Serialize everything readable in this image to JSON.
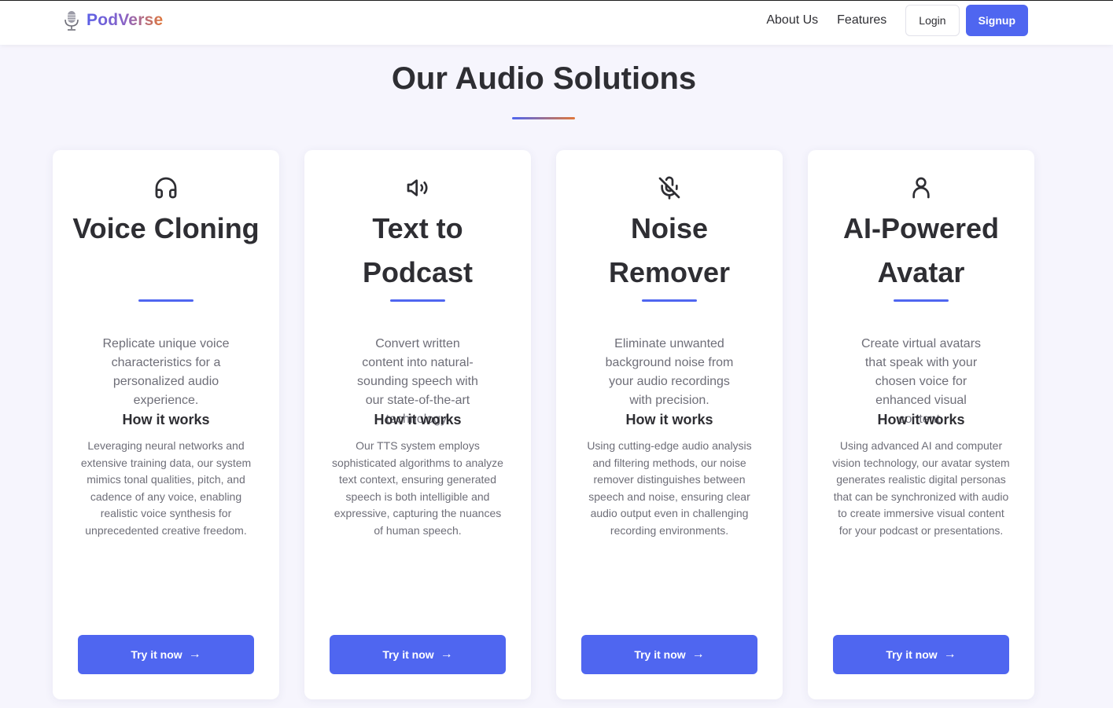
{
  "header": {
    "brand_name": "PodVerse",
    "brand_icon": "microphone-icon",
    "nav": [
      "About Us",
      "Features"
    ],
    "login_label": "Login",
    "signup_label": "Signup"
  },
  "section": {
    "title": "Our Audio Solutions"
  },
  "cards": [
    {
      "icon": "headphones-icon",
      "title": "Voice Cloning",
      "description": "Replicate unique voice characteristics for a personalized audio experience.",
      "how_label": "How it works",
      "detail": "Leveraging neural networks and extensive training data, our system mimics tonal qualities, pitch, and cadence of any voice, enabling realistic voice synthesis for unprecedented creative freedom.",
      "button_label": "Try it now",
      "button_icon": "arrow-right-icon"
    },
    {
      "icon": "speaker-icon",
      "title": "Text to Podcast",
      "description": "Convert written content into natural-sounding speech with our state-of-the-art technology.",
      "how_label": "How it works",
      "detail": "Our TTS system employs sophisticated algorithms to analyze text context, ensuring generated speech is both intelligible and expressive, capturing the nuances of human speech.",
      "button_label": "Try it now",
      "button_icon": "arrow-right-icon"
    },
    {
      "icon": "mic-off-icon",
      "title": "Noise Remover",
      "description": "Eliminate unwanted background noise from your audio recordings with precision.",
      "how_label": "How it works",
      "detail": "Using cutting-edge audio analysis and filtering methods, our noise remover distinguishes between speech and noise, ensuring clear audio output even in challenging recording environments.",
      "button_label": "Try it now",
      "button_icon": "arrow-right-icon"
    },
    {
      "icon": "user-icon",
      "title": "AI-Powered Avatar",
      "description": "Create virtual avatars that speak with your chosen voice for enhanced visual content.",
      "how_label": "How it works",
      "detail": "Using advanced AI and computer vision technology, our avatar system generates realistic digital personas that can be synchronized with audio to create immersive visual content for your podcast or presentations.",
      "button_label": "Try it now",
      "button_icon": "arrow-right-icon"
    }
  ],
  "colors": {
    "accent": "#4f66f0",
    "brand_gradient_start": "#5b5fe6",
    "brand_gradient_end": "#e0773b",
    "background": "#f6f5fd",
    "text_dark": "#2e2e33",
    "text_muted": "#6e6e78"
  }
}
